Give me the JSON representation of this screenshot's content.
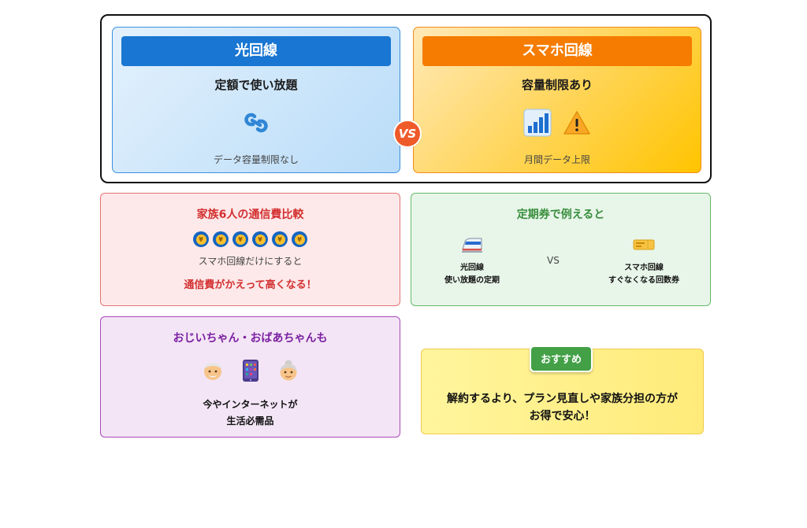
{
  "fiber": {
    "title": "光回線",
    "subtitle": "定額で使い放題",
    "note": "データ容量制限なし",
    "icon": "link-icon"
  },
  "vs_label": "VS",
  "mobile": {
    "title": "スマホ回線",
    "subtitle": "容量制限あり",
    "note": "月間データ上限",
    "icons": [
      "bar-chart-icon",
      "warning-icon"
    ]
  },
  "family": {
    "title": "家族6人の通信費比較",
    "coin_count": 6,
    "text": "スマホ回線だけにすると",
    "warning": "通信費がかえって高くなる！"
  },
  "pass": {
    "title": "定期券で例えると",
    "left_line1": "光回線",
    "left_line2": "使い放題の定期",
    "vs_label": "VS",
    "right_line1": "スマホ回線",
    "right_line2": "すぐなくなる回数券",
    "icons": [
      "train-icon",
      "ticket-icon"
    ]
  },
  "elder": {
    "title": "おじいちゃん・おばあちゃんも",
    "line1": "今やインターネットが",
    "line2": "生活必需品",
    "icons": [
      "grandfather-icon",
      "tablet-icon",
      "grandmother-icon"
    ]
  },
  "recommend": {
    "badge": "おすすめ",
    "line1": "解約するより、プラン見直しや家族分担の方が",
    "line2": "お得で安心！"
  },
  "colors": {
    "fiber_blue": "#1976d2",
    "mobile_orange": "#f57c00",
    "warning_red": "#d32f2f",
    "pass_green": "#388e3c",
    "elder_purple": "#7b1fa2",
    "recommend_green": "#43a047"
  }
}
